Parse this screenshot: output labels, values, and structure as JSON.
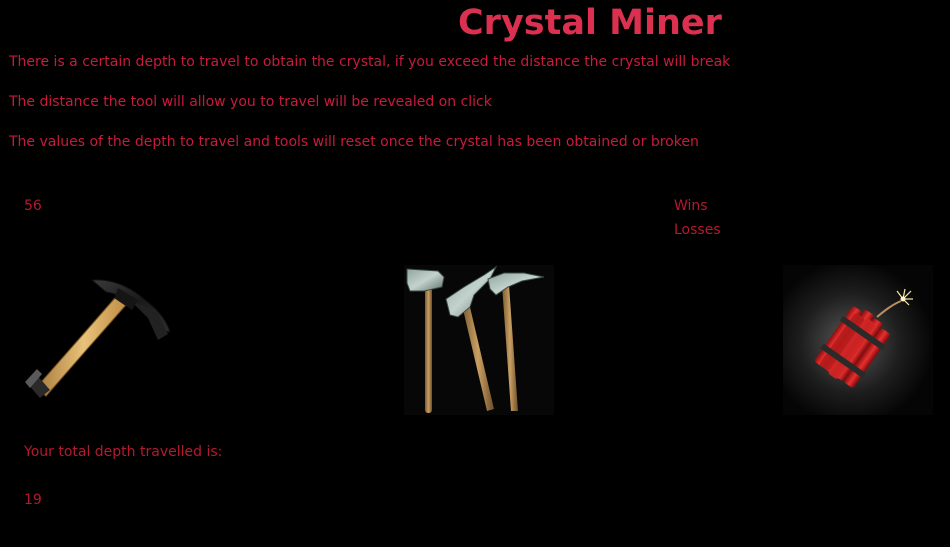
{
  "app": {
    "title": "Crystal Miner"
  },
  "rules": [
    "There is a certain depth to travel to obtain the crystal, if you exceed the distance the crystal will break",
    "The distance the tool will allow you to travel will be revealed on click",
    "The values of the depth to travel and tools will reset once the crystal has been obtained or broken"
  ],
  "scoreboard": {
    "target_depth": "56",
    "wins_label": "Wins",
    "losses_label": "Losses"
  },
  "tools": [
    {
      "name": "pickaxe",
      "icon": "pickaxe-icon"
    },
    {
      "name": "axes",
      "icon": "axes-icon"
    },
    {
      "name": "dynamite",
      "icon": "dynamite-icon"
    }
  ],
  "progress": {
    "total_label": "Your total depth travelled is:",
    "total_value": "19"
  },
  "colors": {
    "background": "#000000",
    "title": "#dc3050",
    "text": "#c81b3c"
  }
}
